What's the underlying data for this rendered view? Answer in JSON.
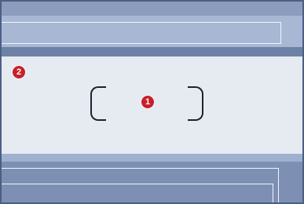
{
  "screen": {
    "markers": [
      {
        "id": "marker-1",
        "label": "1"
      },
      {
        "id": "marker-2",
        "label": "2"
      }
    ],
    "panel_text_faint": "",
    "colors": {
      "frame": "#6d82a6",
      "panel": "#e6ebf2",
      "marker": "#c81f2c",
      "bracket": "#1b2230"
    }
  }
}
